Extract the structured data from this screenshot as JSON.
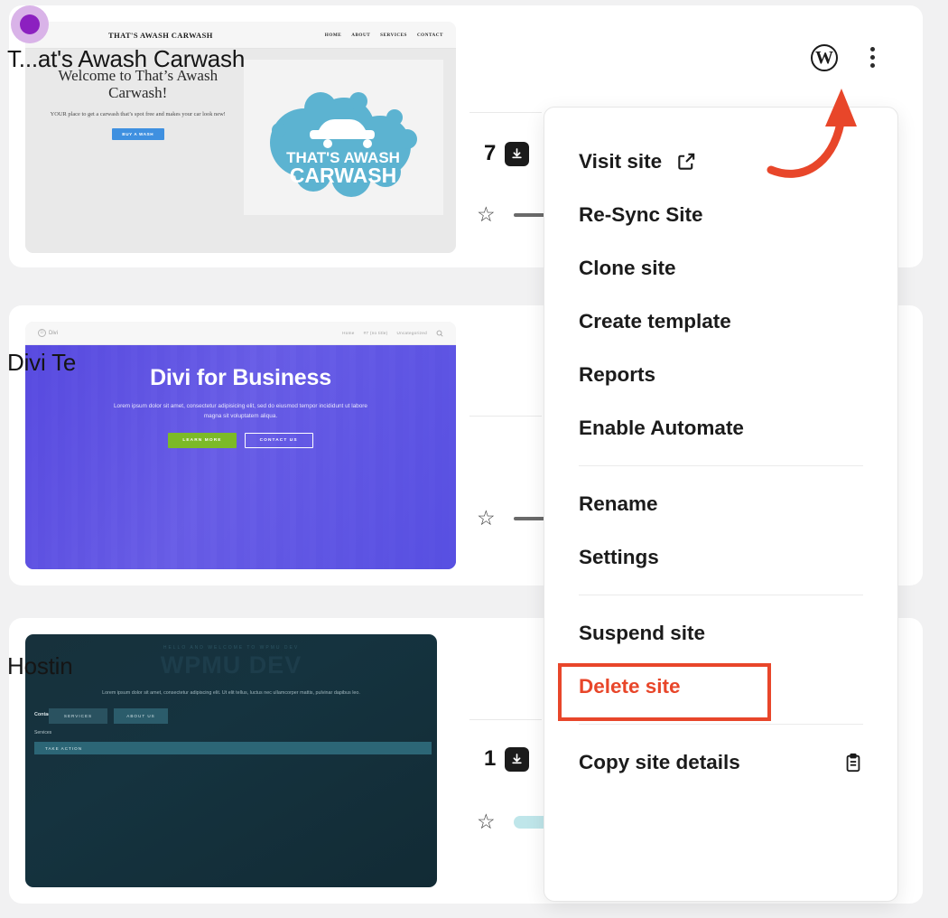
{
  "background_color": "#f1f1f2",
  "accent_red": "#e8462a",
  "cursor": {
    "name": "click-indicator",
    "color": "#8c20c0",
    "halo": "#d9b3e8"
  },
  "sites": [
    {
      "title": "T...at's Awash Carwash",
      "update_count": "7",
      "download_icon": "download-badge-icon",
      "star_icon": "☆",
      "status_bar": "dash",
      "thumbnail": {
        "kind": "carwash",
        "brand": "THAT'S AWASH CARWASH",
        "nav": [
          "HOME",
          "ABOUT",
          "SERVICES",
          "CONTACT"
        ],
        "heading": "Welcome to That’s Awash Carwash!",
        "subtext": "YOUR place to get a carwash that’s spot free and makes your car look new!",
        "cta": "BUY A WASH",
        "logo_line1": "THAT'S AWASH",
        "logo_line2": "CARWASH",
        "logo_color": "#5cb3d1"
      }
    },
    {
      "title": "Divi Te",
      "update_count": "",
      "star_icon": "☆",
      "status_bar": "dash",
      "thumbnail": {
        "kind": "divi",
        "logo": "Divi",
        "nav": [
          "Home",
          "#7 (no title)",
          "Uncategorized"
        ],
        "search_icon": "search-icon",
        "heading": "Divi for Business",
        "paragraph": "Lorem ipsum dolor sit amet, consectetur adipisicing elit, sed do eiusmod tempor incididunt ut labore magna sit voluptatem aliqua.",
        "button_primary": "LEARN MORE",
        "button_secondary": "CONTACT US",
        "primary_color": "#7cba27",
        "hero_color": "#5648e0"
      }
    },
    {
      "title": "Hostin",
      "update_count": "1",
      "download_icon": "download-badge-icon",
      "star_icon": "☆",
      "status_bar": "pill",
      "status_pill_color": "#bfe6ea",
      "thumbnail": {
        "kind": "wpmu",
        "eyebrow": "HELLO AND WELCOME TO WPMU DEV",
        "heading": "WPMU DEV",
        "paragraph": "Lorem ipsum dolor sit amet, consectetur adipiscing elit. Ut elit tellus, luctus nec ullamcorper mattis, pulvinar dapibus leo.",
        "contact_label": "Contact",
        "button_1": "SERVICES",
        "button_2": "ABOUT US",
        "services_label": "Services",
        "cta": "TAKE ACTION",
        "bg_color": "#17313c"
      }
    }
  ],
  "header": {
    "title": "T...at's Awash Carwash",
    "wordpress_icon": "wordpress-icon",
    "wordpress_glyph": "W",
    "kebab_icon": "more-vertical-icon"
  },
  "menu": {
    "items": [
      {
        "label": "Visit site",
        "icon": "external-link-icon",
        "danger": false
      },
      {
        "label": "Re-Sync Site",
        "icon": "",
        "danger": false
      },
      {
        "label": "Clone site",
        "icon": "",
        "danger": false
      },
      {
        "label": "Create template",
        "icon": "",
        "danger": false
      },
      {
        "label": "Reports",
        "icon": "",
        "danger": false
      },
      {
        "label": "Enable Automate",
        "icon": "",
        "danger": false
      },
      {
        "label": "Rename",
        "icon": "",
        "danger": false
      },
      {
        "label": "Settings",
        "icon": "",
        "danger": false
      },
      {
        "label": "Suspend site",
        "icon": "",
        "danger": false,
        "highlighted": true
      },
      {
        "label": "Delete site",
        "icon": "",
        "danger": true
      },
      {
        "label": "Copy site details",
        "icon": "clipboard-icon",
        "danger": false
      }
    ]
  },
  "annotations": {
    "arrow": {
      "name": "curved-arrow-annotation",
      "color": "#e8462a",
      "points_to": "more-vertical-icon"
    },
    "highlight_box": {
      "name": "suspend-site-highlight",
      "color": "#e8462a",
      "targets": "Suspend site"
    }
  }
}
